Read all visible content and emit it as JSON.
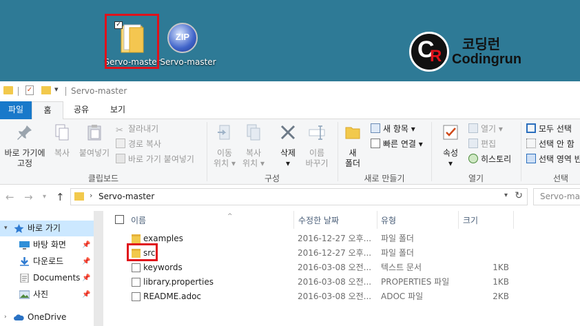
{
  "desktop": {
    "icons": [
      {
        "label": "Servo-master",
        "icon": "folder-icon",
        "selected": true
      },
      {
        "label": "Servo-master",
        "icon": "zip-archive-icon",
        "badge": "ZIP"
      }
    ],
    "brand": {
      "korean": "코딩런",
      "english": "Codingrun",
      "logo_letters": "CR"
    }
  },
  "window": {
    "title": "Servo-master",
    "quick_access_icons": [
      "folder-icon",
      "properties-icon",
      "new-folder-icon",
      "customize-dropdown-icon"
    ]
  },
  "ribbon": {
    "tabs": [
      {
        "label": "파일",
        "active": false
      },
      {
        "label": "홈",
        "active": true
      },
      {
        "label": "공유",
        "active": false
      },
      {
        "label": "보기",
        "active": false
      }
    ],
    "clipboard": {
      "pin_label_1": "바로 가기에",
      "pin_label_2": "고정",
      "copy_label": "복사",
      "paste_label": "붙여넣기",
      "cut_label": "잘라내기",
      "copy_path_label": "경로 복사",
      "paste_shortcut_label": "바로 가기 붙여넣기",
      "group_label": "클립보드"
    },
    "organize": {
      "move_to_1": "이동",
      "move_to_2": "위치",
      "copy_to_1": "복사",
      "copy_to_2": "위치",
      "delete_label": "삭제",
      "rename_1": "이름",
      "rename_2": "바꾸기",
      "group_label": "구성"
    },
    "new": {
      "new_folder_1": "새",
      "new_folder_2": "폴더",
      "new_item_label": "새 항목",
      "easy_access_label": "빠른 연결",
      "group_label": "새로 만들기"
    },
    "open": {
      "properties_label": "속성",
      "open_label": "열기",
      "edit_label": "편집",
      "history_label": "히스토리",
      "group_label": "열기"
    },
    "select": {
      "select_all_label": "모두 선택",
      "select_none_label": "선택 안 함",
      "invert_label": "선택 영역 반",
      "group_label": "선택"
    }
  },
  "address": {
    "path": "Servo-master",
    "search_placeholder": "Servo-maste"
  },
  "navpane": {
    "items": [
      {
        "label": "바로 가기",
        "icon": "star-icon",
        "pinned": false,
        "active": true
      },
      {
        "label": "바탕 화면",
        "icon": "desktop-icon",
        "pinned": true,
        "active": false
      },
      {
        "label": "다운로드",
        "icon": "download-icon",
        "pinned": true,
        "active": false
      },
      {
        "label": "Documents",
        "icon": "documents-icon",
        "pinned": true,
        "active": false
      },
      {
        "label": "사진",
        "icon": "pictures-icon",
        "pinned": true,
        "active": false
      },
      {
        "label": "OneDrive",
        "icon": "cloud-icon",
        "pinned": false,
        "active": false
      }
    ]
  },
  "files": {
    "columns": {
      "name": "이름",
      "date": "수정한 날짜",
      "type": "유형",
      "size": "크기"
    },
    "rows": [
      {
        "name": "examples",
        "date": "2016-12-27 오후...",
        "type": "파일 폴더",
        "size": "",
        "kind": "folder"
      },
      {
        "name": "src",
        "date": "2016-12-27 오후...",
        "type": "파일 폴더",
        "size": "",
        "kind": "folder",
        "highlighted": true
      },
      {
        "name": "keywords",
        "date": "2016-03-08 오전...",
        "type": "텍스트 문서",
        "size": "1KB",
        "kind": "file"
      },
      {
        "name": "library.properties",
        "date": "2016-03-08 오전...",
        "type": "PROPERTIES 파일",
        "size": "1KB",
        "kind": "file"
      },
      {
        "name": "README.adoc",
        "date": "2016-03-08 오전...",
        "type": "ADOC 파일",
        "size": "2KB",
        "kind": "file"
      }
    ]
  },
  "colors": {
    "desktop_bg": "#2e7a96",
    "highlight_box": "#e0121b",
    "file_tab_bg": "#1979ca",
    "folder_yellow": "#f2c94c",
    "nav_active_bg": "#cce8ff"
  }
}
